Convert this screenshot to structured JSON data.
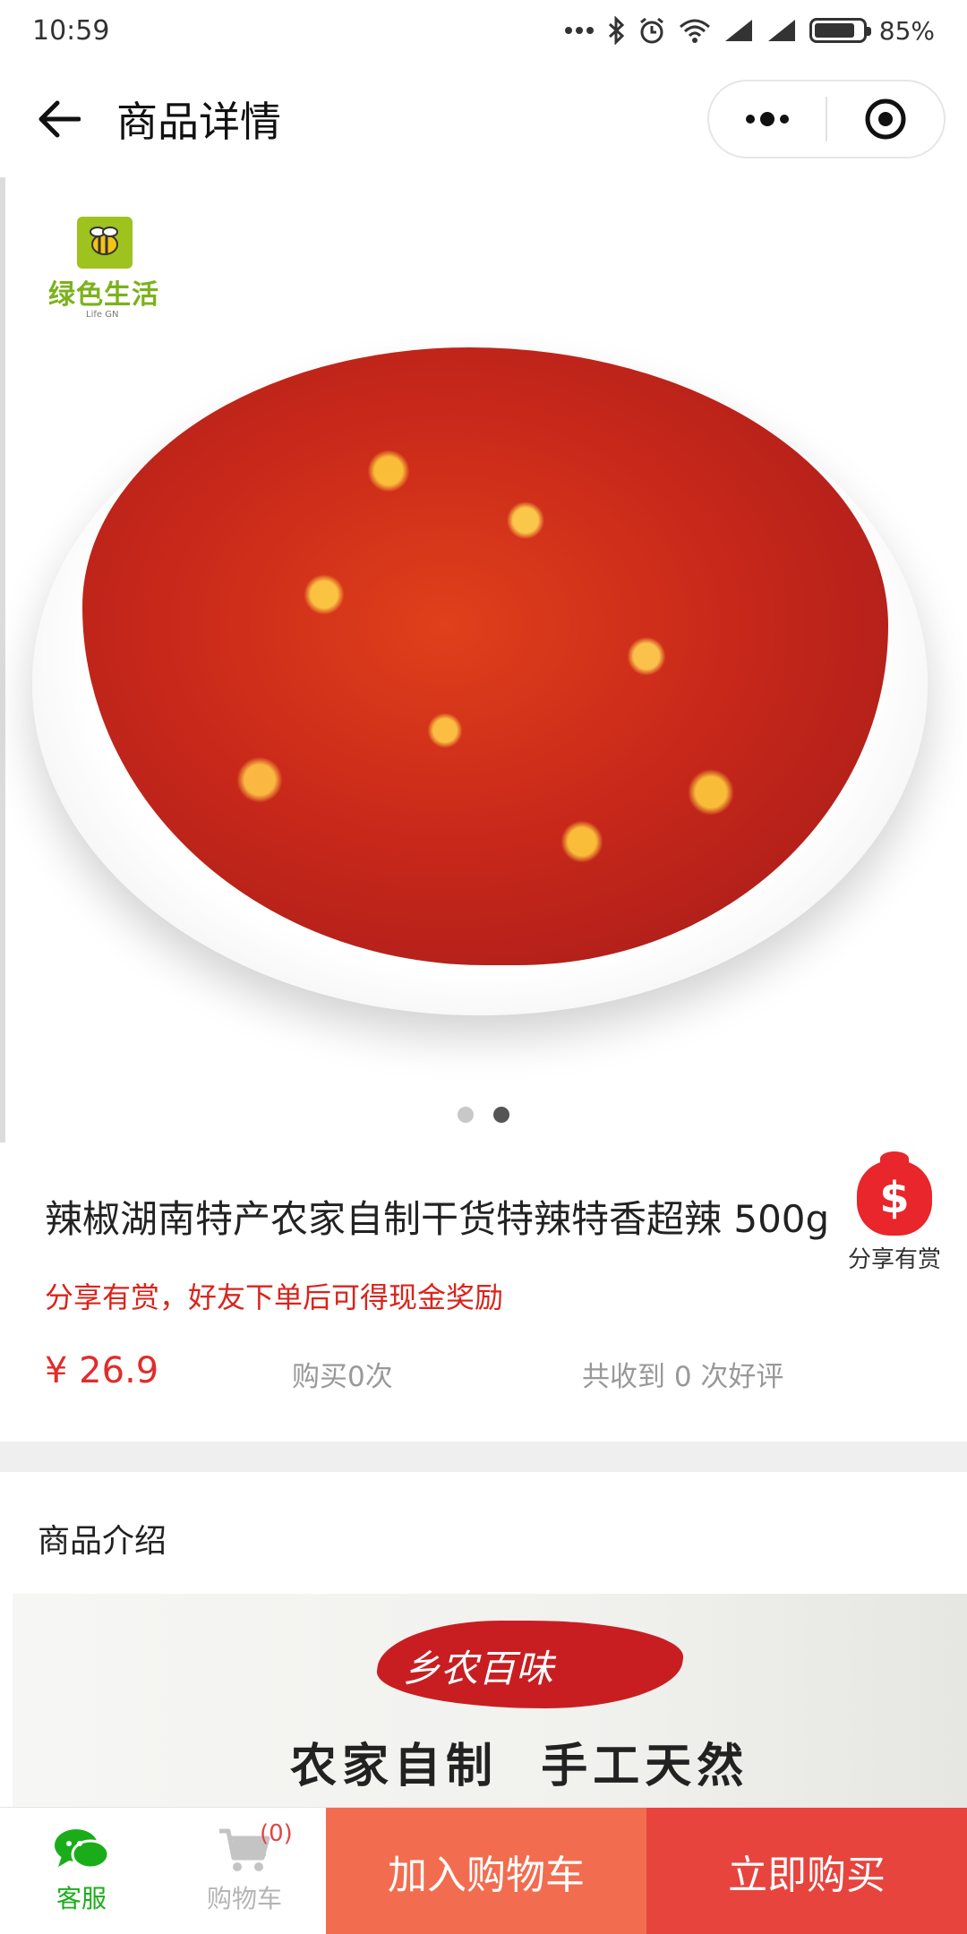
{
  "status_bar": {
    "time": "10:59",
    "battery_percent": "85%",
    "battery_level": 0.85,
    "icons": [
      "more-dots-icon",
      "bluetooth-icon",
      "alarm-icon",
      "wifi-icon",
      "signal-icon",
      "signal-icon",
      "battery-icon"
    ]
  },
  "nav": {
    "title": "商品详情",
    "back_icon": "back-arrow-icon",
    "menu_icon": "more-dots-icon",
    "close_icon": "target-circle-icon"
  },
  "gallery": {
    "brand_name": "绿色生活",
    "brand_sub": "Life GN",
    "slide_count": 2,
    "active_slide": 2
  },
  "product": {
    "title": "辣椒湖南特产农家自制干货特辣特香超辣 500g",
    "share_label": "分享有赏",
    "share_icon": "money-bag-icon",
    "reward_text": "分享有赏，好友下单后可得现金奖励",
    "price": "¥ 26.9",
    "buy_count": "购买0次",
    "praise_count": "共收到 0 次好评"
  },
  "intro": {
    "title": "商品介绍",
    "banner_brush_text": "乡农百味",
    "banner_calligraphy": "农家自制  手工天然"
  },
  "bottom_bar": {
    "service_label": "客服",
    "cart_label": "购物车",
    "cart_badge": "(0)",
    "add_to_cart": "加入购物车",
    "buy_now": "立即购买"
  },
  "colors": {
    "accent_red": "#e8443e",
    "add_cart_orange": "#f26d4f",
    "price_red": "#e02c2c",
    "service_green": "#1aad19"
  }
}
